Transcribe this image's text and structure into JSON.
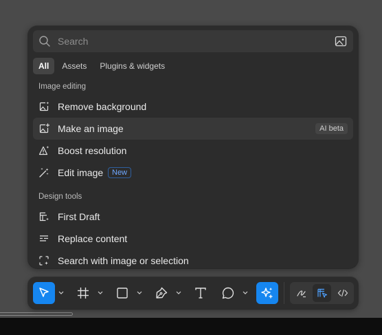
{
  "search": {
    "placeholder": "Search",
    "value": ""
  },
  "tabs": [
    {
      "label": "All",
      "active": true
    },
    {
      "label": "Assets",
      "active": false
    },
    {
      "label": "Plugins & widgets",
      "active": false
    }
  ],
  "sections": [
    {
      "title": "Image editing",
      "items": [
        {
          "label": "Remove background",
          "icon": "sparkle-image-icon"
        },
        {
          "label": "Make an image",
          "icon": "image-plus-icon",
          "badge": "AI beta",
          "highlighted": true
        },
        {
          "label": "Boost resolution",
          "icon": "boost-triangle-icon"
        },
        {
          "label": "Edit image",
          "icon": "magic-wand-icon",
          "badge": "New"
        }
      ]
    },
    {
      "title": "Design tools",
      "items": [
        {
          "label": "First Draft",
          "icon": "layout-sparkle-icon"
        },
        {
          "label": "Replace content",
          "icon": "text-lines-icon"
        },
        {
          "label": "Search with image or selection",
          "icon": "scan-sparkle-icon"
        }
      ]
    }
  ],
  "toolbar": {
    "tools": [
      "move-tool",
      "frame-tool",
      "shape-tool",
      "pen-tool",
      "text-tool",
      "comment-tool",
      "actions-tool"
    ],
    "active_tool": "actions-tool",
    "modes": [
      "draw-mode",
      "design-mode",
      "dev-mode"
    ],
    "active_mode": "design-mode"
  },
  "colors": {
    "accent": "#1686f0",
    "panel": "#2c2c2c",
    "canvas": "#4a4a4a",
    "badge_new": "#6fa8ff"
  }
}
